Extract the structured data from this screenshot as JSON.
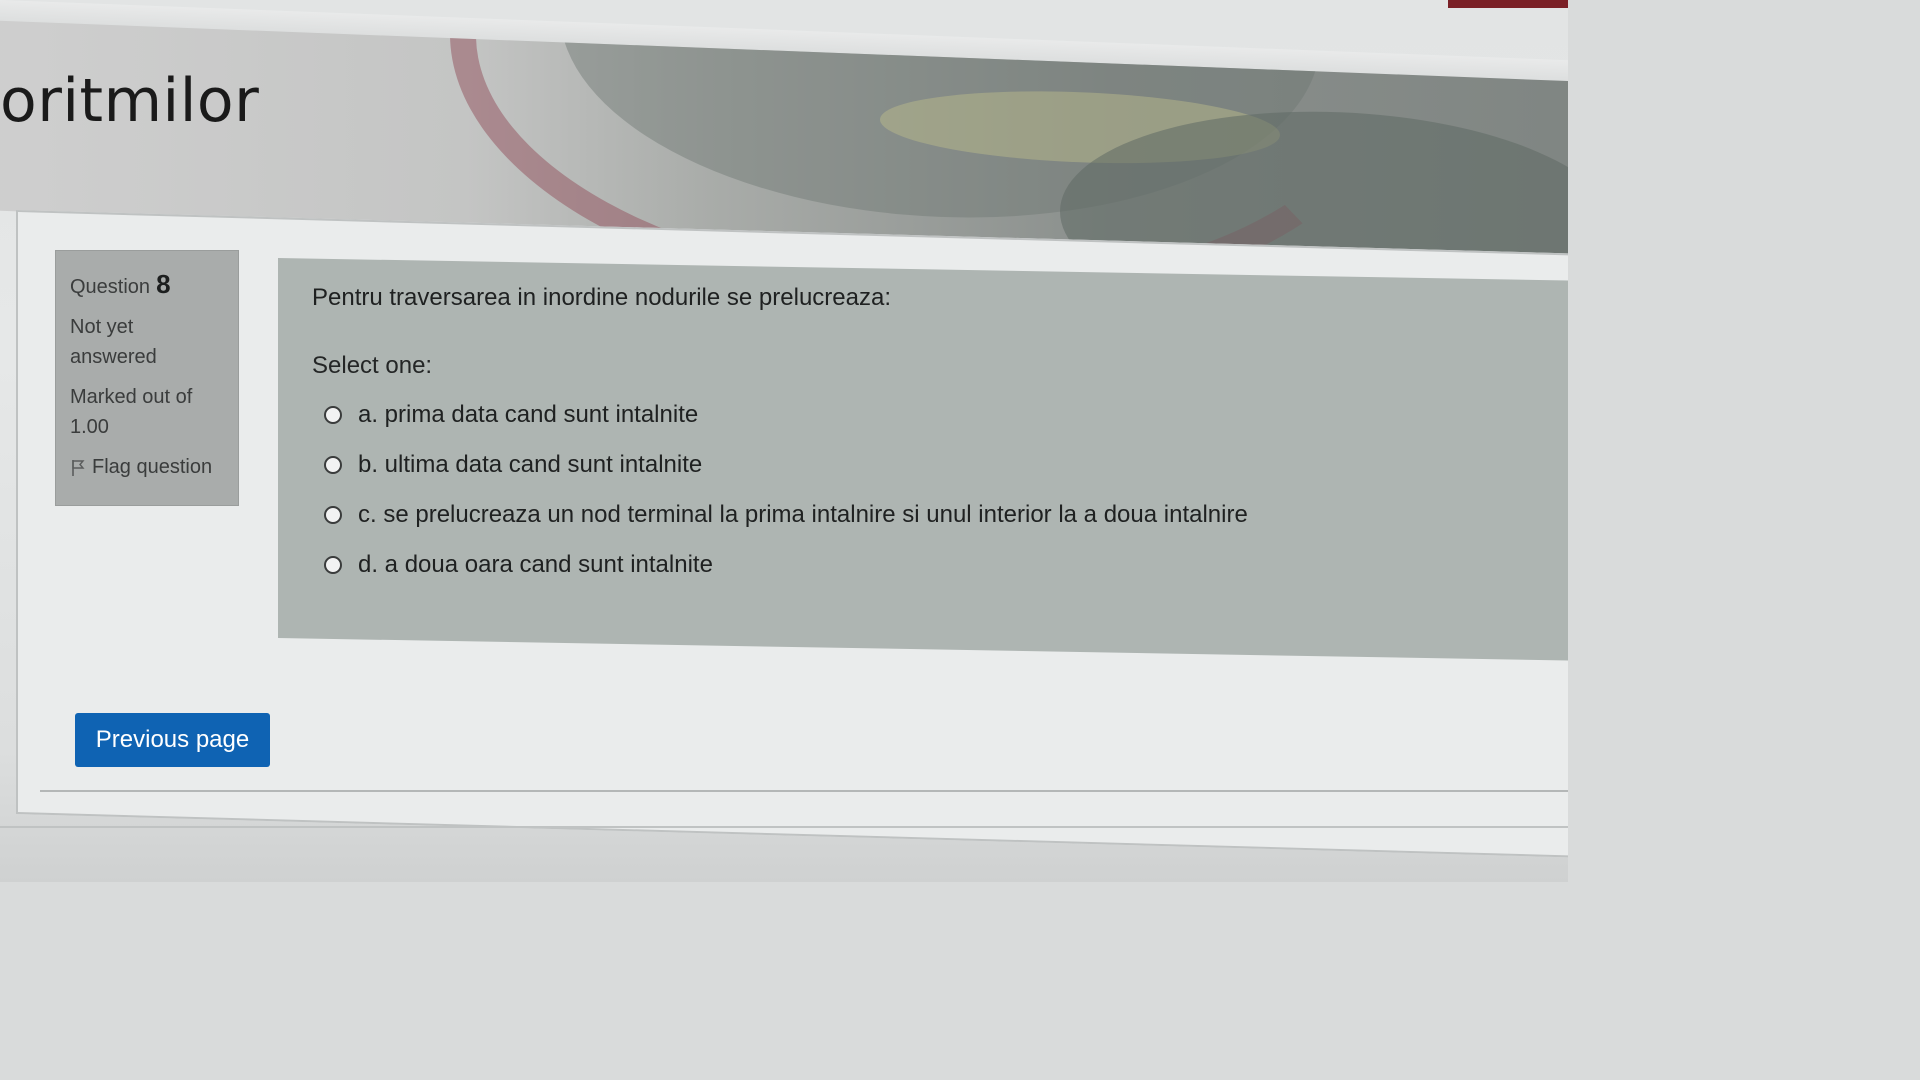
{
  "header": {
    "course_title": "oritmilor"
  },
  "question_info": {
    "label": "Question",
    "number": "8",
    "state": "Not yet answered",
    "grade": "Marked out of 1.00",
    "flag_label": "Flag question"
  },
  "question": {
    "text": "Pentru traversarea in inordine nodurile se prelucreaza:",
    "prompt": "Select one:",
    "answers": [
      {
        "label": "a. prima data cand sunt intalnite"
      },
      {
        "label": "b. ultima data cand sunt intalnite"
      },
      {
        "label": "c. se prelucreaza un nod terminal la prima intalnire si unul interior la a doua intalnire"
      },
      {
        "label": "d. a doua oara cand sunt intalnite"
      }
    ]
  },
  "navigation": {
    "previous_label": "Previous page"
  },
  "colors": {
    "button_bg": "#0f63b3",
    "info_bg": "#a9acab",
    "content_bg": "#aeb5b2",
    "accent": "#7a2026"
  }
}
